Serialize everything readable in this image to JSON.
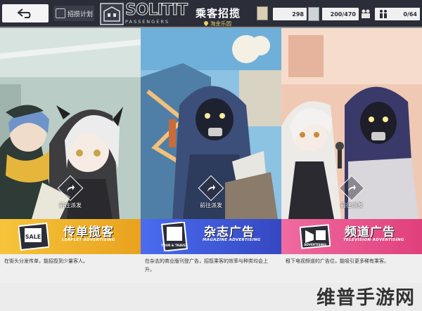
{
  "topbar": {
    "back_icon": "back-arrow-icon",
    "plan_label": "招揽计划",
    "logo_main": "SOLITIT",
    "logo_sub": "PASSENGERS",
    "title": "乘客招揽",
    "location": "淘金乐园",
    "stat1": "298",
    "stat2": "200/470",
    "stat3": "0/64"
  },
  "panels": [
    {
      "id": "leaflet",
      "dispatch_label": "前往派发",
      "title": "传单揽客",
      "subtitle": "LEAFLET ADVERTISING",
      "description": "在街头分发传单，能招揽到少量客人。",
      "banner_color": "#f2b22a",
      "emblem_text": "SALE"
    },
    {
      "id": "magazine",
      "dispatch_label": "前往派发",
      "title": "杂志广告",
      "subtitle": "MAGAZINE ADVERTISING",
      "description": "在杂志的商业版刊登广告，招揽乘客的效率与种类均会上升。",
      "banner_color": "#3a58d6",
      "emblem_text": "TOUR & TRAVEL"
    },
    {
      "id": "television",
      "dispatch_label": "前往派发",
      "title": "频道广告",
      "subtitle": "TELEVISION ADVERTISING",
      "description": "租下电视频道的广告位，能吸引更多稀有乘客。",
      "banner_color": "#e94a8c",
      "emblem_text": "ADVERTISING"
    }
  ],
  "watermark": "维普手游网"
}
